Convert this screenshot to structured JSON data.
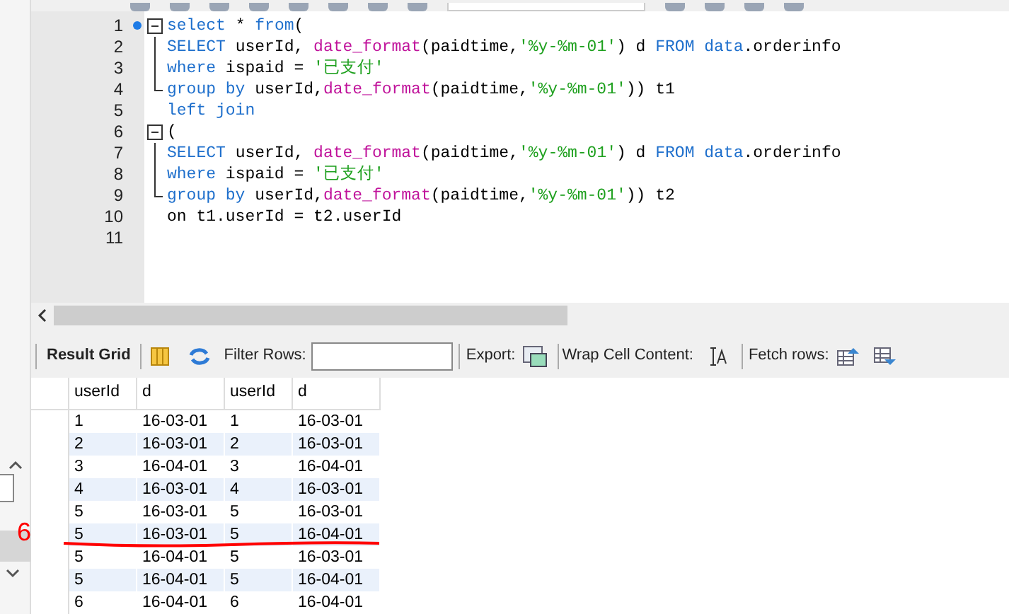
{
  "editor": {
    "lines": [
      {
        "number": "1",
        "marker": true,
        "kind": "opener",
        "tokens": [
          {
            "text": "select",
            "kind": "keyword"
          },
          {
            "text": " * ",
            "kind": "plain"
          },
          {
            "text": "from",
            "kind": "keyword"
          },
          {
            "text": "(",
            "kind": "plain"
          }
        ]
      },
      {
        "number": "2",
        "marker": false,
        "kind": "body",
        "tokens": [
          {
            "text": "SELECT",
            "kind": "keyword"
          },
          {
            "text": " userId, ",
            "kind": "plain"
          },
          {
            "text": "date_format",
            "kind": "function"
          },
          {
            "text": "(paidtime,",
            "kind": "plain"
          },
          {
            "text": "'%y-%m-01'",
            "kind": "string"
          },
          {
            "text": ") d ",
            "kind": "plain"
          },
          {
            "text": "FROM data",
            "kind": "keyword"
          },
          {
            "text": ".orderinfo",
            "kind": "plain"
          }
        ]
      },
      {
        "number": "3",
        "marker": false,
        "kind": "body",
        "tokens": [
          {
            "text": "where",
            "kind": "keyword"
          },
          {
            "text": " ispaid = ",
            "kind": "plain"
          },
          {
            "text": "'已支付'",
            "kind": "string"
          }
        ]
      },
      {
        "number": "4",
        "marker": false,
        "kind": "closer",
        "tokens": [
          {
            "text": "group by",
            "kind": "keyword"
          },
          {
            "text": " userId,",
            "kind": "plain"
          },
          {
            "text": "date_format",
            "kind": "function"
          },
          {
            "text": "(paidtime,",
            "kind": "plain"
          },
          {
            "text": "'%y-%m-01'",
            "kind": "string"
          },
          {
            "text": ")) t1",
            "kind": "plain"
          }
        ]
      },
      {
        "number": "5",
        "marker": false,
        "kind": "plain",
        "tokens": [
          {
            "text": "left join",
            "kind": "keyword"
          }
        ]
      },
      {
        "number": "6",
        "marker": false,
        "kind": "opener",
        "tokens": [
          {
            "text": "(",
            "kind": "plain"
          }
        ]
      },
      {
        "number": "7",
        "marker": false,
        "kind": "body",
        "tokens": [
          {
            "text": "SELECT",
            "kind": "keyword"
          },
          {
            "text": " userId, ",
            "kind": "plain"
          },
          {
            "text": "date_format",
            "kind": "function"
          },
          {
            "text": "(paidtime,",
            "kind": "plain"
          },
          {
            "text": "'%y-%m-01'",
            "kind": "string"
          },
          {
            "text": ") d ",
            "kind": "plain"
          },
          {
            "text": "FROM data",
            "kind": "keyword"
          },
          {
            "text": ".orderinfo",
            "kind": "plain"
          }
        ]
      },
      {
        "number": "8",
        "marker": false,
        "kind": "body",
        "tokens": [
          {
            "text": "where",
            "kind": "keyword"
          },
          {
            "text": " ispaid = ",
            "kind": "plain"
          },
          {
            "text": "'已支付'",
            "kind": "string"
          }
        ]
      },
      {
        "number": "9",
        "marker": false,
        "kind": "closer",
        "tokens": [
          {
            "text": "group by",
            "kind": "keyword"
          },
          {
            "text": " userId,",
            "kind": "plain"
          },
          {
            "text": "date_format",
            "kind": "function"
          },
          {
            "text": "(paidtime,",
            "kind": "plain"
          },
          {
            "text": "'%y-%m-01'",
            "kind": "string"
          },
          {
            "text": ")) t2",
            "kind": "plain"
          }
        ]
      },
      {
        "number": "10",
        "marker": false,
        "kind": "plain",
        "tokens": [
          {
            "text": "on t1.userId = t2.userId",
            "kind": "plain"
          }
        ]
      },
      {
        "number": "11",
        "marker": false,
        "kind": "plain"
      }
    ]
  },
  "result_toolbar": {
    "tab": "Result Grid",
    "filter_label": "Filter Rows:",
    "export_label": "Export:",
    "wrap_label": "Wrap Cell Content:",
    "fetch_label": "Fetch rows:"
  },
  "table": {
    "columns": [
      "userId",
      "d",
      "userId",
      "d"
    ],
    "rows": [
      [
        "1",
        "16-03-01",
        "1",
        "16-03-01"
      ],
      [
        "2",
        "16-03-01",
        "2",
        "16-03-01"
      ],
      [
        "3",
        "16-04-01",
        "3",
        "16-04-01"
      ],
      [
        "4",
        "16-03-01",
        "4",
        "16-03-01"
      ],
      [
        "5",
        "16-03-01",
        "5",
        "16-03-01"
      ],
      [
        "5",
        "16-03-01",
        "5",
        "16-04-01"
      ],
      [
        "5",
        "16-04-01",
        "5",
        "16-03-01"
      ],
      [
        "5",
        "16-04-01",
        "5",
        "16-04-01"
      ],
      [
        "6",
        "16-04-01",
        "6",
        "16-04-01"
      ]
    ]
  },
  "annotation": {
    "label": "6",
    "color": "#ff0000"
  }
}
